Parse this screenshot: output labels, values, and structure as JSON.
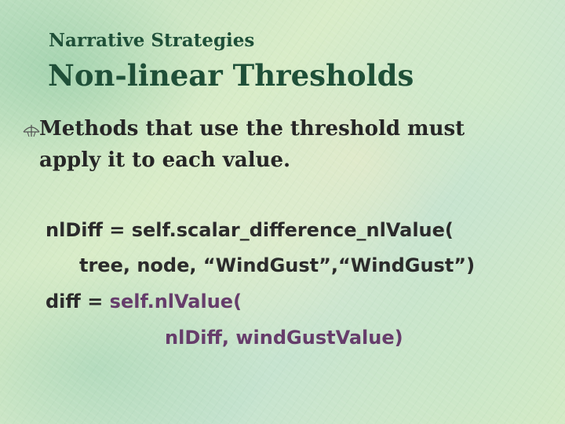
{
  "slide": {
    "subtitle": "Narrative Strategies",
    "title": "Non-linear Thresholds",
    "bullet": {
      "icon": "pen-nib-icon",
      "text": "Methods that use the threshold must\napply it to each value."
    },
    "code": {
      "line1": "nlDiff = self.scalar_difference_nlValue(",
      "line2": "tree, node, “WindGust”,“WindGust”)",
      "line3_prefix": "diff = ",
      "line3_call": "self.nlValue(",
      "line4": "nlDiff, windGustValue)"
    }
  },
  "colors": {
    "heading": "#1f4f38",
    "body_text": "#262626",
    "code_highlight": "#663d6b"
  }
}
